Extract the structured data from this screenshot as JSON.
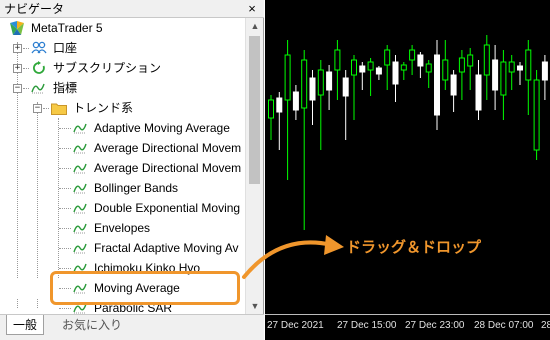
{
  "navigator": {
    "title": "ナビゲータ",
    "close": "×",
    "root": "MetaTrader 5",
    "accounts": "口座",
    "subscriptions": "サブスクリプション",
    "indicators": "指標",
    "trend_folder": "トレンド系",
    "items": [
      "Adaptive Moving Average",
      "Average Directional Movem",
      "Average Directional Movem",
      "Bollinger Bands",
      "Double Exponential Moving",
      "Envelopes",
      "Fractal Adaptive Moving Av",
      "Ichimoku Kinko Hyo",
      "Moving Average",
      "Parabolic SAR"
    ],
    "tabs": [
      "一般",
      "お気に入り"
    ]
  },
  "chart": {
    "x_labels": [
      "27 Dec 2021",
      "27 Dec 15:00",
      "27 Dec 23:00",
      "28 Dec 07:00",
      "28 Dec"
    ],
    "bull_color": "#00ff00",
    "bear_color": "#ffffff",
    "background": "#000000"
  },
  "annotation": {
    "drag_drop": "ドラッグ＆ドロップ",
    "accent": "#f0962c"
  }
}
